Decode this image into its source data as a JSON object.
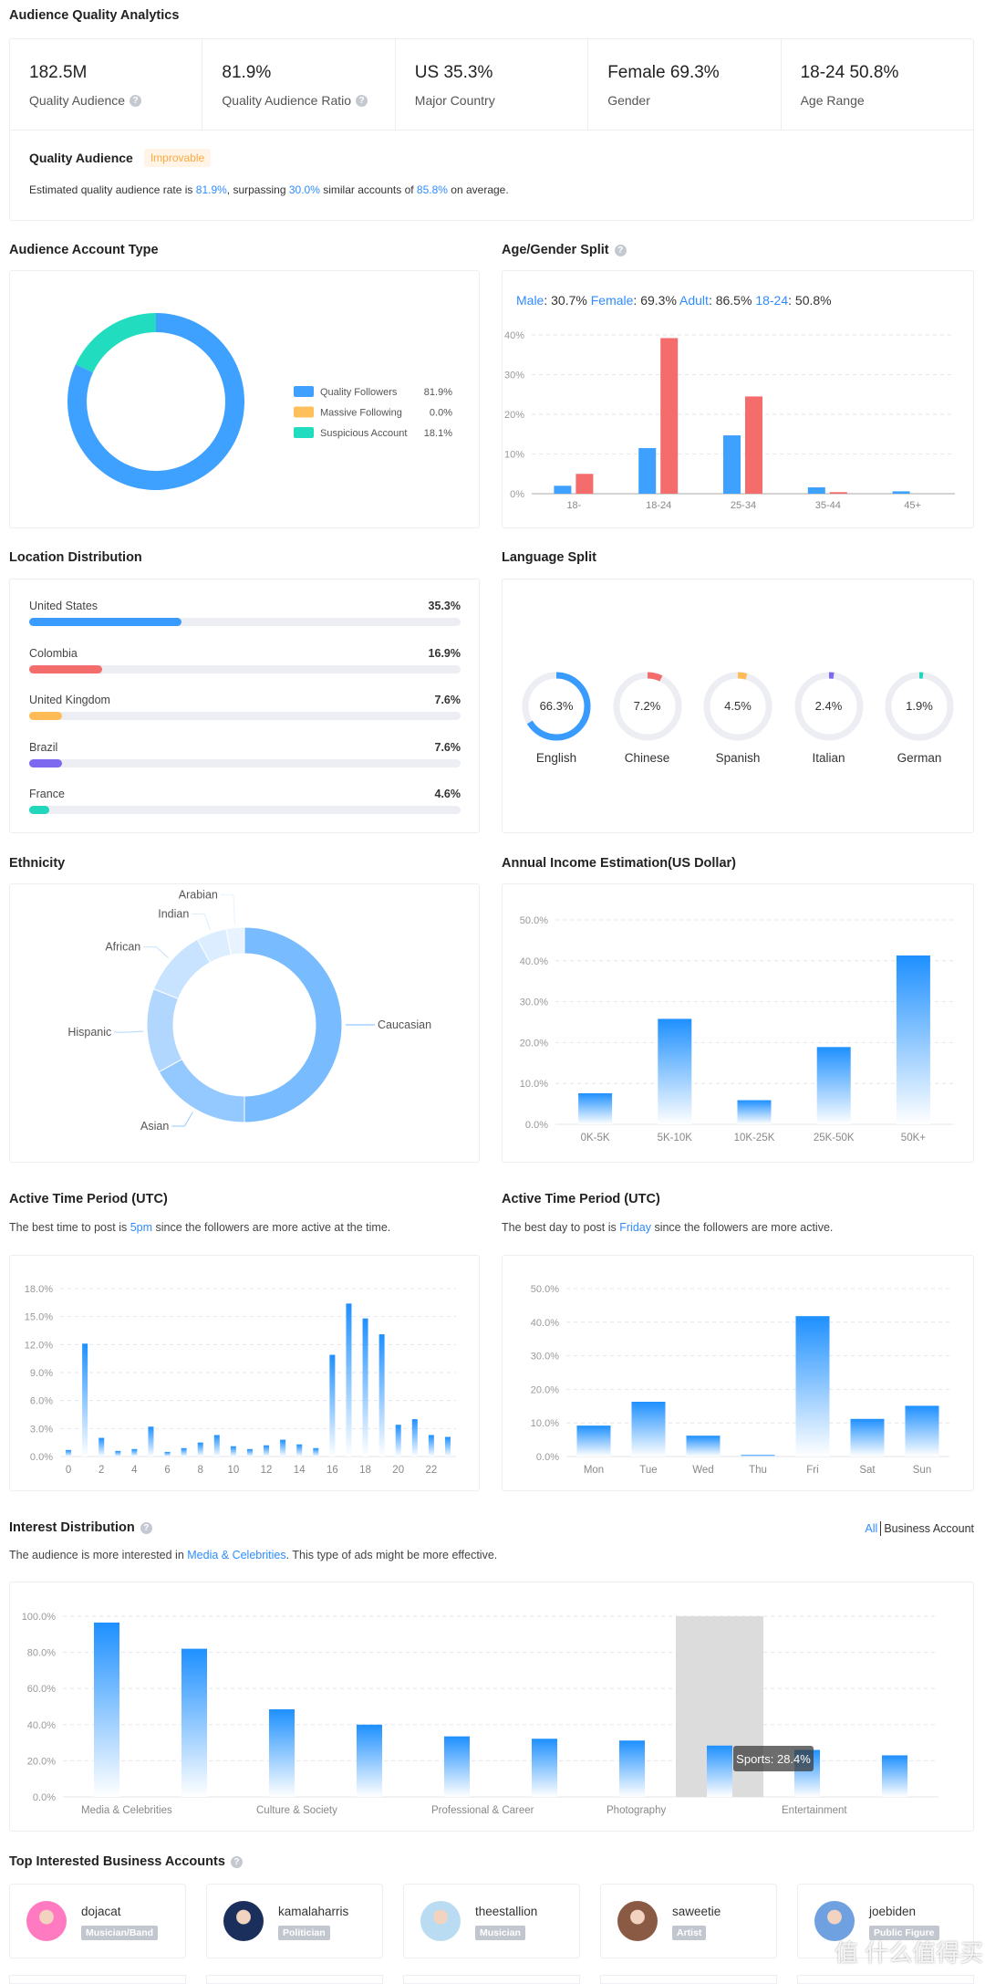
{
  "title": "Audience Quality Analytics",
  "stats": [
    {
      "value": "182.5M",
      "label": "Quality Audience",
      "help": true
    },
    {
      "value": "81.9%",
      "label": "Quality Audience Ratio",
      "help": true
    },
    {
      "value": "US 35.3%",
      "label": "Major Country",
      "help": false
    },
    {
      "value": "Female 69.3%",
      "label": "Gender",
      "help": false
    },
    {
      "value": "18-24 50.8%",
      "label": "Age Range",
      "help": false
    }
  ],
  "quality": {
    "title": "Quality Audience",
    "badge": "Improvable",
    "text_1": "Estimated quality audience rate is ",
    "rate": "81.9%",
    "text_2": ", surpassing ",
    "surpass": "30.0%",
    "text_3": " similar accounts of ",
    "avg": "85.8%",
    "text_4": " on average."
  },
  "account_type": {
    "title": "Audience Account Type"
  },
  "age_gender": {
    "title": "Age/Gender Split",
    "summary": [
      {
        "k": "Male",
        "v": ": 30.7% "
      },
      {
        "k": "Female",
        "v": ": 69.3% "
      },
      {
        "k": "Adult",
        "v": ": 86.5% "
      },
      {
        "k": "18-24",
        "v": ": 50.8%"
      }
    ]
  },
  "location": {
    "title": "Location Distribution",
    "items": [
      {
        "name": "United States",
        "pct": "35.3%",
        "value": 35.3,
        "color": "#3a9bff"
      },
      {
        "name": "Colombia",
        "pct": "16.9%",
        "value": 16.9,
        "color": "#f46d6d"
      },
      {
        "name": "United Kingdom",
        "pct": "7.6%",
        "value": 7.6,
        "color": "#ffbb55"
      },
      {
        "name": "Brazil",
        "pct": "7.6%",
        "value": 7.6,
        "color": "#7d68f0"
      },
      {
        "name": "France",
        "pct": "4.6%",
        "value": 4.6,
        "color": "#22d6bb"
      }
    ]
  },
  "language": {
    "title": "Language Split",
    "items": [
      {
        "name": "English",
        "pct": "66.3%",
        "value": 66.3,
        "color": "#3a9bff"
      },
      {
        "name": "Chinese",
        "pct": "7.2%",
        "value": 7.2,
        "color": "#f46d6d"
      },
      {
        "name": "Spanish",
        "pct": "4.5%",
        "value": 4.5,
        "color": "#ffbb55"
      },
      {
        "name": "Italian",
        "pct": "2.4%",
        "value": 2.4,
        "color": "#7d68f0"
      },
      {
        "name": "German",
        "pct": "1.9%",
        "value": 1.9,
        "color": "#22d6bb"
      }
    ]
  },
  "ethnicity": {
    "title": "Ethnicity"
  },
  "income": {
    "title": "Annual Income Estimation(US Dollar)"
  },
  "active_hour": {
    "title": "Active Time Period (UTC)",
    "text_1": "The best time to post is ",
    "best": "5pm",
    "text_2": " since the followers are more active at the time."
  },
  "active_day": {
    "title": "Active Time Period (UTC)",
    "text_1": "The best day to post is ",
    "best": "Friday",
    "text_2": " since the followers are more active."
  },
  "interest": {
    "title": "Interest Distribution",
    "text_1": "The audience is more interested in ",
    "top": "Media & Celebrities",
    "text_2": ". This type of ads might be more effective.",
    "toggle_all": "All",
    "toggle_business": "Business Account",
    "tooltip": "Sports: 28.4%"
  },
  "business": {
    "title": "Top Interested Business Accounts",
    "accounts": [
      {
        "name": "dojacat",
        "tag": "Musician/Band",
        "color": "#ff7ac0"
      },
      {
        "name": "kamalaharris",
        "tag": "Politician",
        "color": "#1b2f5c"
      },
      {
        "name": "theestallion",
        "tag": "Musician",
        "color": "#b9dcf2"
      },
      {
        "name": "saweetie",
        "tag": "Artist",
        "color": "#8a5a44"
      },
      {
        "name": "joebiden",
        "tag": "Public Figure",
        "color": "#6fa0e0"
      }
    ]
  },
  "watermark": "值 什么值得买",
  "chart_data": [
    {
      "id": "account_type",
      "type": "pie",
      "donut": true,
      "categories": [
        "Quality Followers",
        "Massive Following",
        "Suspicious Account"
      ],
      "values": [
        81.9,
        0.0,
        18.1
      ],
      "labels": [
        "81.9%",
        "0.0%",
        "18.1%"
      ],
      "colors": [
        "#3ea1ff",
        "#ffbf5a",
        "#22dcbf"
      ],
      "legend": "right"
    },
    {
      "id": "age_gender",
      "type": "bar",
      "categories": [
        "18-",
        "18-24",
        "25-34",
        "35-44",
        "45+"
      ],
      "series": [
        {
          "values": [
            2.0,
            11.5,
            14.7,
            1.6,
            0.6
          ],
          "color": "#3ea1ff"
        },
        {
          "values": [
            5.0,
            39.2,
            24.5,
            0.4,
            0
          ],
          "color": "#f56c6c"
        }
      ],
      "yticks": [
        "0%",
        "10%",
        "20%",
        "30%",
        "40%"
      ],
      "ylim": [
        0,
        40
      ],
      "grid": true
    },
    {
      "id": "ethnicity",
      "type": "pie",
      "donut": true,
      "categories": [
        "Caucasian",
        "Asian",
        "Hispanic",
        "African",
        "Indian",
        "Arabian"
      ],
      "values": [
        50,
        17,
        14,
        11,
        5,
        3
      ],
      "colors": [
        "#78bbff",
        "#94c9ff",
        "#b1d7ff",
        "#c8e3ff",
        "#dcedff",
        "#e8f3ff"
      ]
    },
    {
      "id": "income",
      "type": "bar",
      "categories": [
        "0K-5K",
        "5K-10K",
        "10K-25K",
        "25K-50K",
        "50K+"
      ],
      "values": [
        7.6,
        25.8,
        5.9,
        18.9,
        41.3
      ],
      "yticks": [
        "0.0%",
        "10.0%",
        "20.0%",
        "30.0%",
        "40.0%",
        "50.0%"
      ],
      "ylim": [
        0,
        50
      ],
      "grid": true
    },
    {
      "id": "active_hour",
      "type": "bar",
      "categories": [
        "0",
        "1",
        "2",
        "3",
        "4",
        "5",
        "6",
        "7",
        "8",
        "9",
        "10",
        "11",
        "12",
        "13",
        "14",
        "15",
        "16",
        "17",
        "18",
        "19",
        "20",
        "21",
        "22",
        "23"
      ],
      "xtick_labels": [
        "0",
        "2",
        "4",
        "6",
        "8",
        "10",
        "12",
        "14",
        "16",
        "18",
        "20",
        "22"
      ],
      "values": [
        0.7,
        12.1,
        2.0,
        0.6,
        0.8,
        3.2,
        0.5,
        0.9,
        1.5,
        2.3,
        1.1,
        0.8,
        1.2,
        1.8,
        1.3,
        0.9,
        10.9,
        16.4,
        14.8,
        13.1,
        3.4,
        4.0,
        2.3,
        2.1
      ],
      "yticks": [
        "0.0%",
        "3.0%",
        "6.0%",
        "9.0%",
        "12.0%",
        "15.0%",
        "18.0%"
      ],
      "ylim": [
        0,
        18
      ],
      "grid": true
    },
    {
      "id": "active_day",
      "type": "bar",
      "categories": [
        "Mon",
        "Tue",
        "Wed",
        "Thu",
        "Fri",
        "Sat",
        "Sun"
      ],
      "values": [
        9.2,
        16.3,
        6.2,
        0.5,
        41.8,
        11.2,
        15.1
      ],
      "yticks": [
        "0.0%",
        "10.0%",
        "20.0%",
        "30.0%",
        "40.0%",
        "50.0%"
      ],
      "ylim": [
        0,
        50
      ],
      "grid": true
    },
    {
      "id": "interest",
      "type": "bar",
      "xtick_labels": [
        "Media & Celebrities",
        "",
        "Culture & Society",
        "",
        "Professional & Career",
        "",
        "Photography",
        "",
        "Entertainment",
        ""
      ],
      "values": [
        96.5,
        82.0,
        48.5,
        40.0,
        33.5,
        32.2,
        31.2,
        28.4,
        26.0,
        23.0
      ],
      "highlight_index": 7,
      "yticks": [
        "0.0%",
        "20.0%",
        "40.0%",
        "60.0%",
        "80.0%",
        "100.0%"
      ],
      "ylim": [
        0,
        100
      ],
      "grid": true
    }
  ]
}
